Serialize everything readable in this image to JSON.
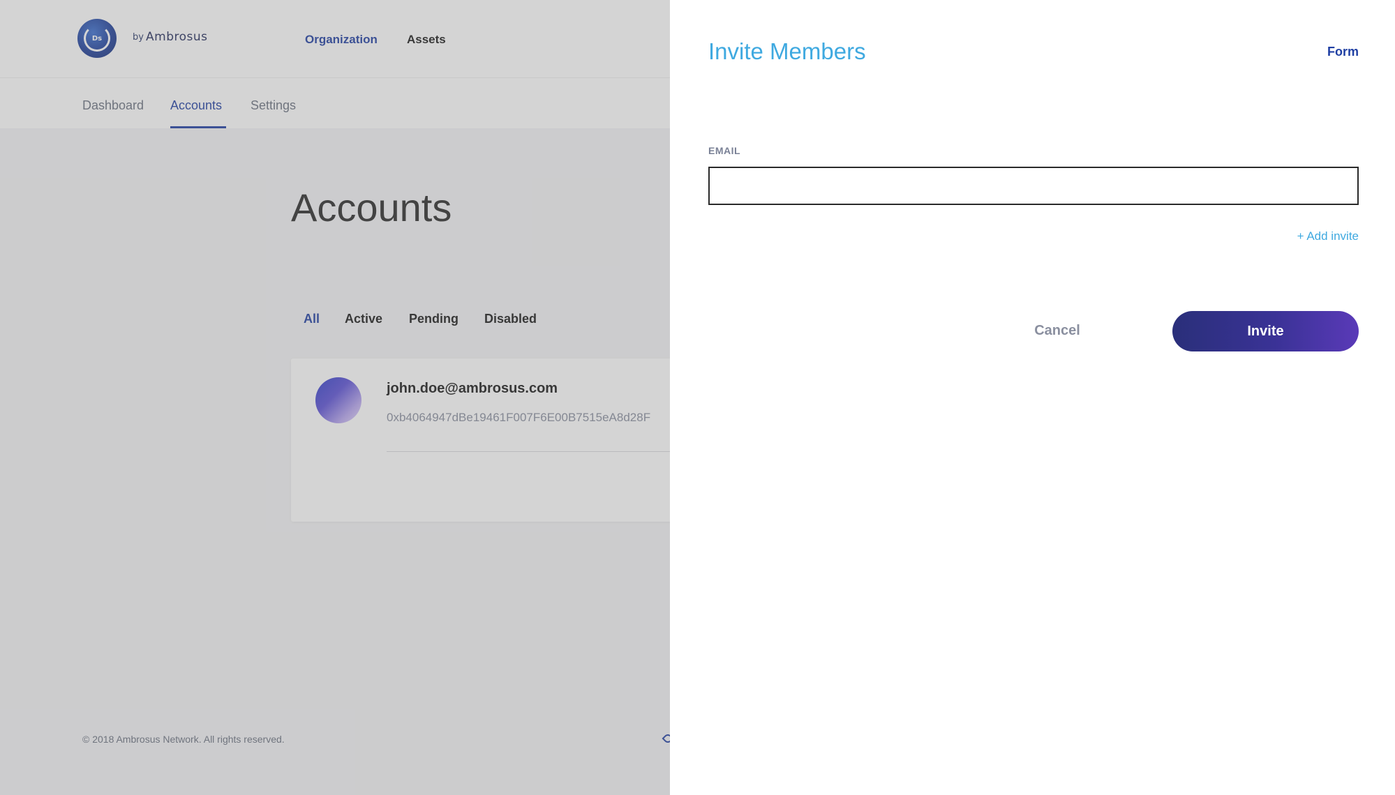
{
  "header": {
    "logo_text": "Ds",
    "by_label": "by",
    "brand": "Ambrosus",
    "nav": [
      {
        "label": "Organization"
      },
      {
        "label": "Assets"
      }
    ]
  },
  "subnav": {
    "items": [
      {
        "label": "Dashboard"
      },
      {
        "label": "Accounts"
      },
      {
        "label": "Settings"
      }
    ],
    "active": "Accounts"
  },
  "main": {
    "title": "Accounts",
    "filters": [
      {
        "label": "All"
      },
      {
        "label": "Active"
      },
      {
        "label": "Pending"
      },
      {
        "label": "Disabled"
      }
    ],
    "active_filter": "All",
    "account": {
      "email": "john.doe@ambrosus.com",
      "address": "0xb4064947dBe19461F007F6E00B7515eA8d28F"
    }
  },
  "footer": {
    "copyright": "© 2018 Ambrosus Network. All rights reserved."
  },
  "drawer": {
    "title": "Invite Members",
    "mode": "Form",
    "email_label": "EMAIL",
    "email_value": "",
    "add_invite": "+ Add invite",
    "cancel": "Cancel",
    "invite": "Invite"
  },
  "colors": {
    "primary": "#1f3fa3",
    "accent_blue": "#3fa9e0",
    "button_gradient_start": "#2a2f7a",
    "button_gradient_end": "#5a3ab8"
  }
}
